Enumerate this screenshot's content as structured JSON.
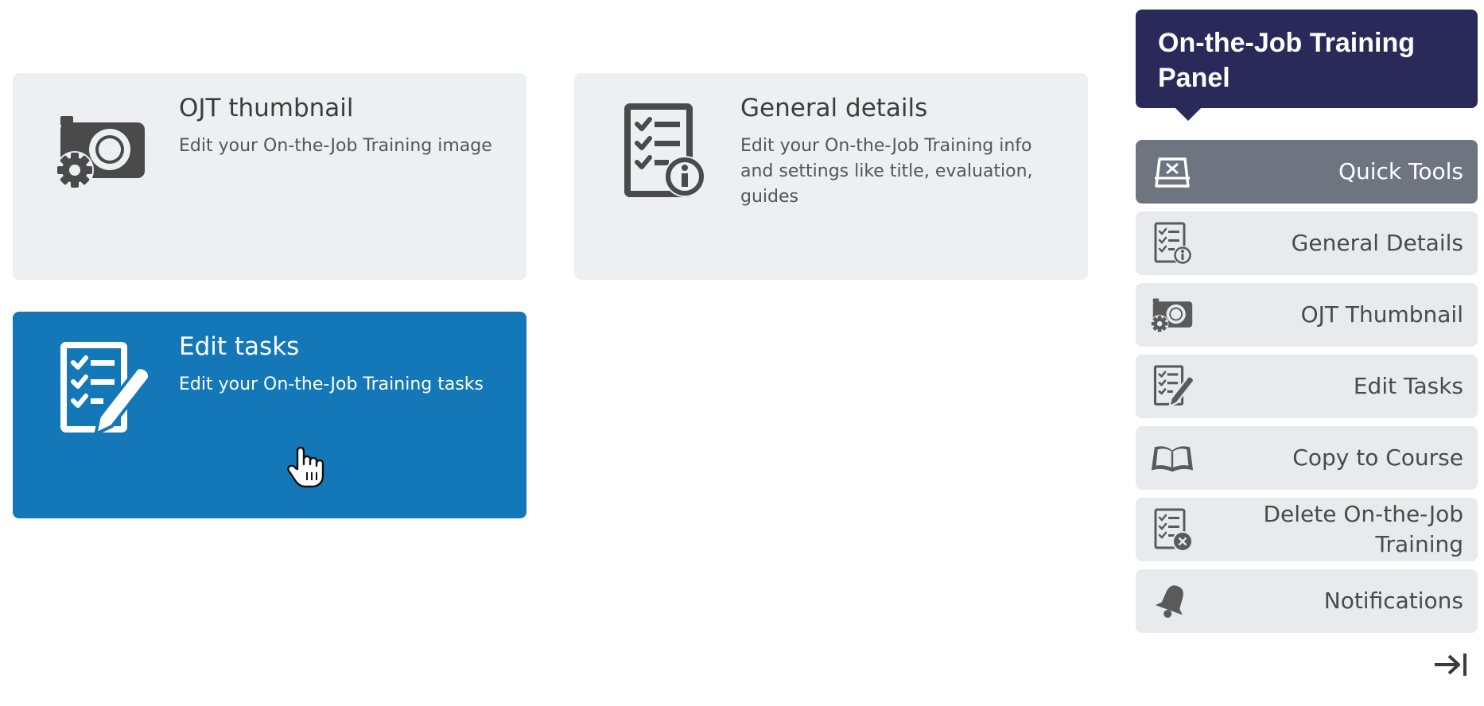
{
  "cards": [
    {
      "title": "OJT thumbnail",
      "description": "Edit your On-the-Job Training image",
      "icon": "camera-gear-icon"
    },
    {
      "title": "General details",
      "description": "Edit your On-the-Job Training info and settings like title, evaluation, guides",
      "icon": "checklist-info-icon"
    },
    {
      "title": "Edit tasks",
      "description": "Edit your On-the-Job Training tasks",
      "icon": "checklist-pen-icon",
      "active": true
    }
  ],
  "panel": {
    "title": "On-the-Job Training Panel",
    "header_color": "#2a2a5a",
    "items": [
      {
        "label": "Quick Tools",
        "icon": "quick-tools-icon",
        "selected": true
      },
      {
        "label": "General Details",
        "icon": "checklist-info-icon"
      },
      {
        "label": "OJT Thumbnail",
        "icon": "camera-gear-icon"
      },
      {
        "label": "Edit Tasks",
        "icon": "checklist-pen-icon"
      },
      {
        "label": "Copy to Course",
        "icon": "book-icon"
      },
      {
        "label": "Delete On-the-Job Training",
        "icon": "checklist-delete-icon"
      },
      {
        "label": "Notifications",
        "icon": "bell-icon"
      }
    ]
  },
  "colors": {
    "accent": "#1478b8",
    "card_bg": "#eeeff2",
    "menu_bg": "#e9eaed",
    "menu_selected_bg": "#6e7480"
  }
}
